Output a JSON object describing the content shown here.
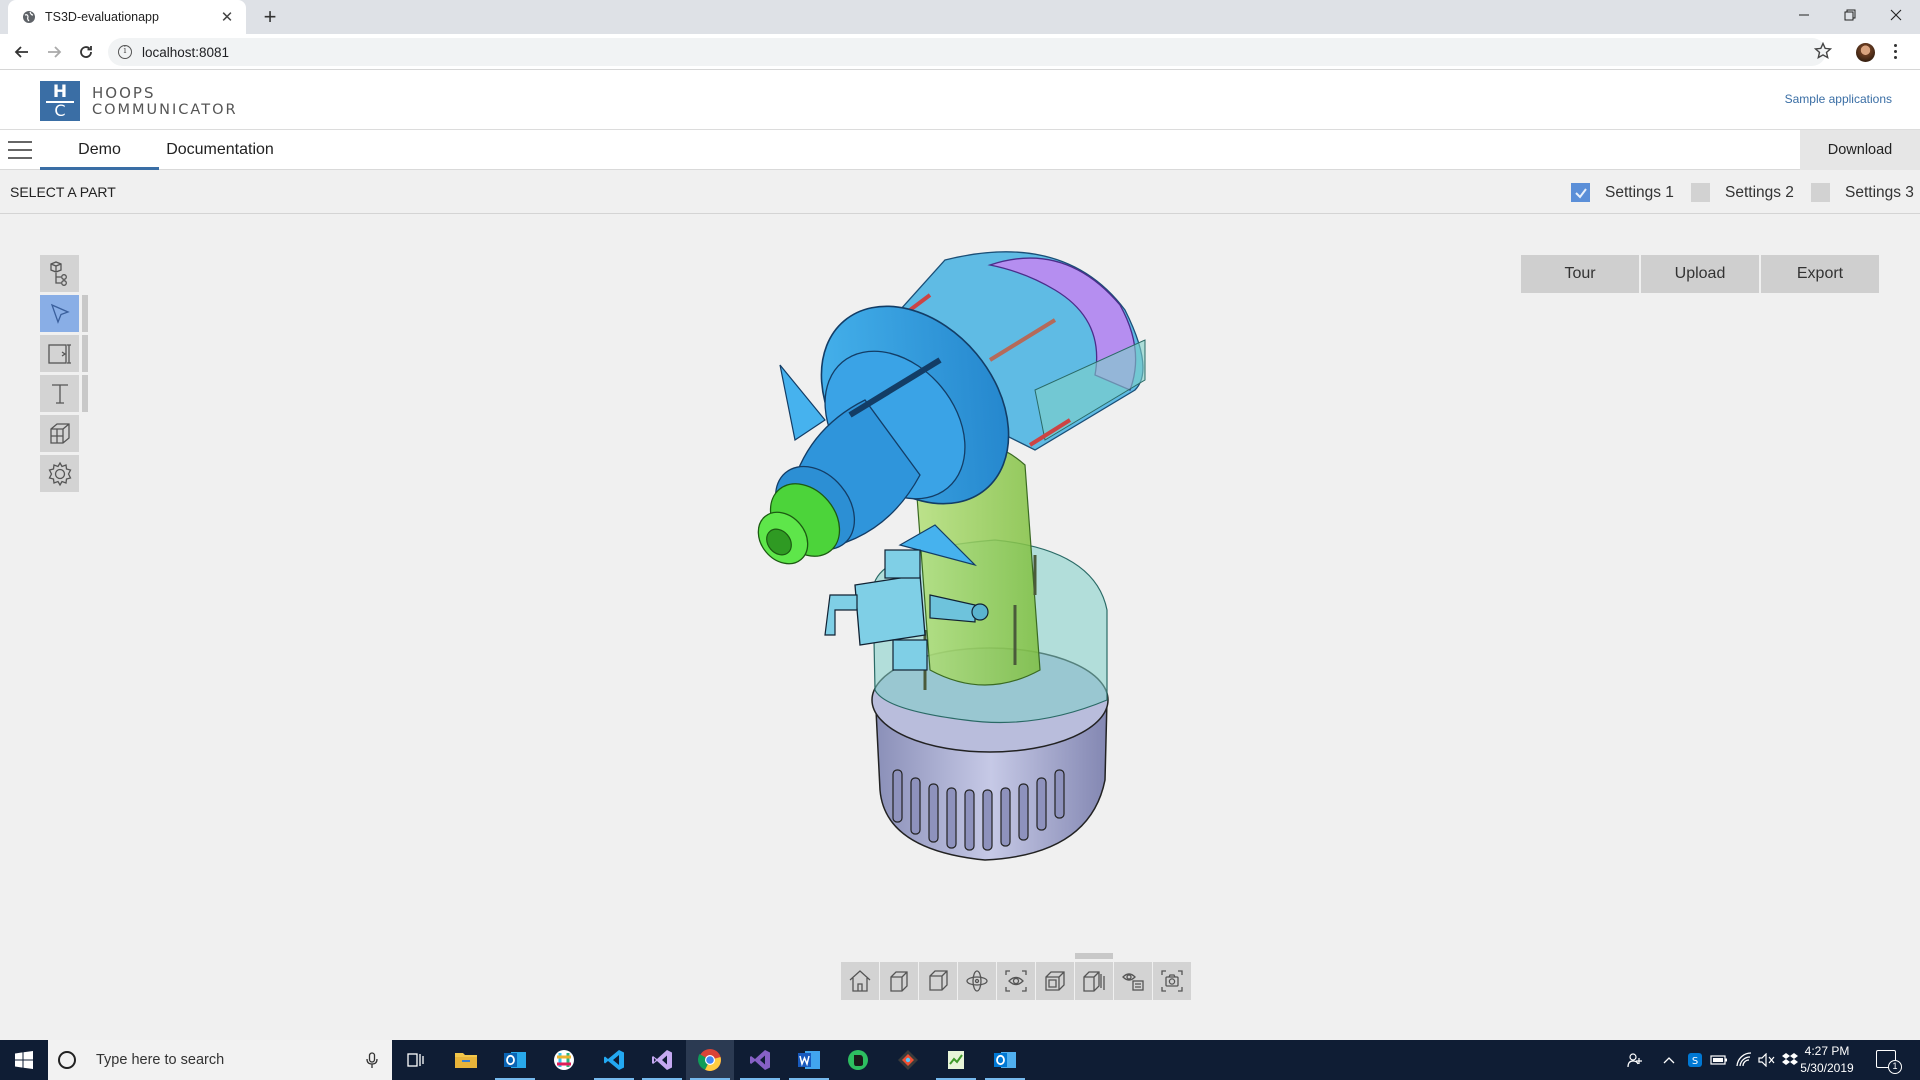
{
  "browser": {
    "tab_title": "TS3D-evaluationapp",
    "url": "localhost:8081"
  },
  "app": {
    "logo_letter_top": "H",
    "logo_letter_bottom": "C",
    "logo_line1": "HOOPS",
    "logo_line2": "COMMUNICATOR",
    "sample_link": "Sample applications"
  },
  "nav": {
    "tabs": [
      {
        "label": "Demo",
        "active": true
      },
      {
        "label": "Documentation",
        "active": false
      }
    ],
    "download_label": "Download"
  },
  "subheader": {
    "status": "SELECT A PART",
    "settings": [
      {
        "label": "Settings 1",
        "checked": true
      },
      {
        "label": "Settings 2",
        "checked": false
      },
      {
        "label": "Settings 3",
        "checked": false
      }
    ]
  },
  "viewer": {
    "buttons": [
      "Tour",
      "Upload",
      "Export"
    ],
    "left_tools": [
      "model-tree-icon",
      "select-pointer-icon",
      "snapshot-frame-icon",
      "markup-text-icon",
      "cutting-plane-icon",
      "settings-gear-icon"
    ],
    "bottom_tools": [
      "home-icon",
      "camera-view-icon",
      "cube-view-icon",
      "orbit-icon",
      "redline-icon",
      "draw-mode-icon",
      "explode-icon",
      "hidden-line-icon",
      "snapshot-icon"
    ]
  },
  "taskbar": {
    "search_placeholder": "Type here to search",
    "time": "4:27 PM",
    "date": "5/30/2019",
    "notifications": "1"
  },
  "colors": {
    "accent": "#3a6ea5",
    "active_tool": "#89aee6",
    "checkbox_checked": "#5b8fd8",
    "taskbar": "#0f1d34"
  }
}
